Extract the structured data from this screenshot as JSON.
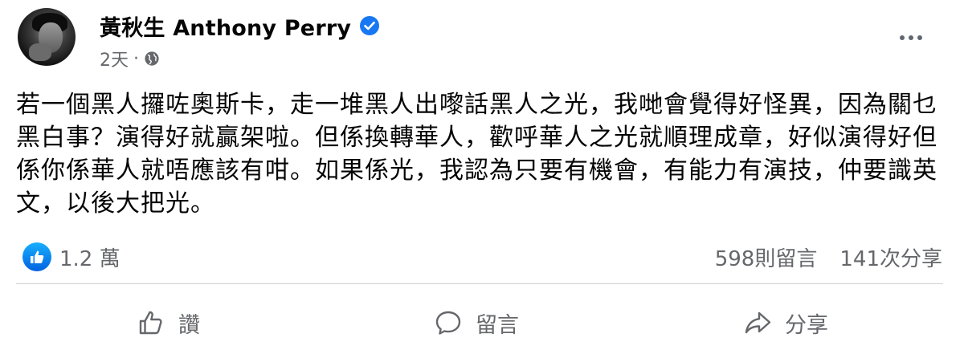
{
  "post": {
    "author": "黃秋生 Anthony Perry",
    "time": "2天",
    "separator": "·",
    "body_lines": [
      "若一個黑人攞咗奧斯卡，走一堆黑人出嚟話黑人之光，我哋會覺得好怪異，因為關乜",
      "黑白事？演得好就贏架啦。但係換轉華人，歡呼華人之光就順理成章，好似演得好但",
      "係你係華人就唔應該有咁。如果係光，我認為只要有機會，有能力有演技，仲要識英",
      "文，以後大把光。"
    ],
    "reactions": "1.2 萬",
    "comments": "598則留言",
    "shares": "141次分享"
  },
  "actions": {
    "like_label": "讚",
    "comment_label": "留言",
    "share_label": "分享"
  },
  "icons": {
    "verified": "verified-badge-icon",
    "audience": "globe-icon",
    "more": "more-options-icon",
    "like_reaction": "thumbs-up-icon",
    "like": "thumbs-up-outline-icon",
    "comment": "comment-bubble-icon",
    "share": "share-arrow-icon"
  },
  "colors": {
    "brand_blue": "#1877f2",
    "secondary_text": "#65676b",
    "primary_text": "#050505",
    "divider": "#ced0d4"
  }
}
